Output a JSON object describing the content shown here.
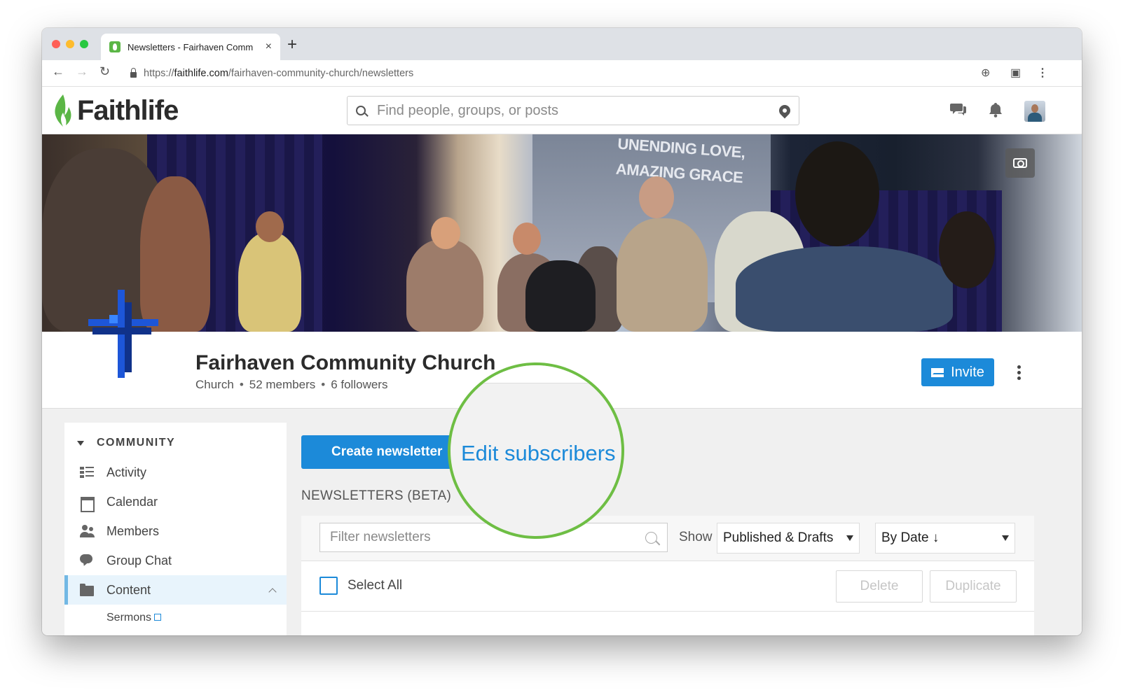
{
  "browser": {
    "tab_title": "Newsletters - Fairhaven Comm",
    "tab_close": "×",
    "new_tab": "+",
    "url_prefix": "https://",
    "url_host": "faithlife.com",
    "url_path": "/fairhaven-community-church/newsletters"
  },
  "site": {
    "logo_text": "Faithlife",
    "search_placeholder": "Find people, groups, or posts",
    "brand_green": "#5bb646",
    "accent_blue": "#1c8ad9"
  },
  "banner": {
    "screen_text_line1": "UNENDING LOVE,",
    "screen_text_line2": "AMAZING GRACE"
  },
  "group": {
    "name": "Fairhaven Community Church",
    "type": "Church",
    "members": "52 members",
    "followers": "6 followers",
    "invite_label": "Invite"
  },
  "sidebar": {
    "section_label": "COMMUNITY",
    "items": [
      {
        "label": "Activity",
        "icon": "activity-icon"
      },
      {
        "label": "Calendar",
        "icon": "calendar-icon"
      },
      {
        "label": "Members",
        "icon": "members-icon"
      },
      {
        "label": "Group Chat",
        "icon": "chat-icon"
      },
      {
        "label": "Content",
        "icon": "folder-icon"
      }
    ],
    "sub_item": "Sermons"
  },
  "newsletters": {
    "create_button": "Create newsletter",
    "callout_link": "Edit subscribers",
    "section_title": "NEWSLETTERS (BETA)",
    "filter_placeholder": "Filter newsletters",
    "show_label": "Show",
    "status_selected": "Published & Drafts",
    "sort_selected": "By Date ↓",
    "select_all_label": "Select All",
    "delete_label": "Delete",
    "duplicate_label": "Duplicate"
  }
}
